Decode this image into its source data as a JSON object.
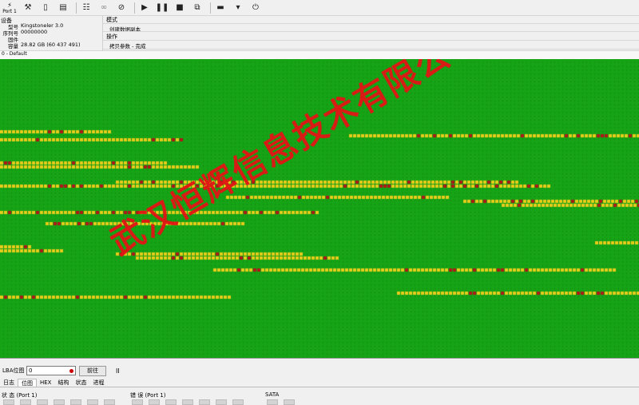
{
  "toolbar": {
    "port_label": "Port 1",
    "icons": [
      "port-icon",
      "tools-icon",
      "drive-icon",
      "log-icon",
      "sectors-icon",
      "binoculars-icon",
      "disk-write-icon",
      "play-icon",
      "pause-icon",
      "stop-icon",
      "copy-icon",
      "monitor-icon",
      "dropdown-icon",
      "power-icon"
    ]
  },
  "device": {
    "header": "设备",
    "model_key": "型号",
    "model_value": "Kingstoneler 3.0",
    "serial_key": "序列号",
    "serial_value": "00000000",
    "firmware_key": "固件",
    "firmware_value": "",
    "capacity_key": "容量",
    "capacity_value": "28.82 GB (60 437 491)"
  },
  "mode": {
    "label": "模式",
    "value": "创建数据副本",
    "op_label": "操作",
    "op_value": "拷贝参数 - 完成"
  },
  "map": {
    "title": "0 - Default",
    "colors": {
      "good": "#16a316",
      "warn": "#e8cc1a",
      "bad": "#b01818"
    }
  },
  "watermark": "武汉恒辉信息技术有限公司",
  "lba": {
    "label": "LBA位图",
    "value": "0",
    "goto_label": "前往",
    "pause_symbol": "II"
  },
  "tabs": [
    "日志",
    "位图",
    "HEX",
    "结构",
    "状态",
    "进程"
  ],
  "status": {
    "state_title": "状 态 (Port 1)",
    "error_title": "错 误 (Port 1)",
    "sata_title": "SATA"
  }
}
